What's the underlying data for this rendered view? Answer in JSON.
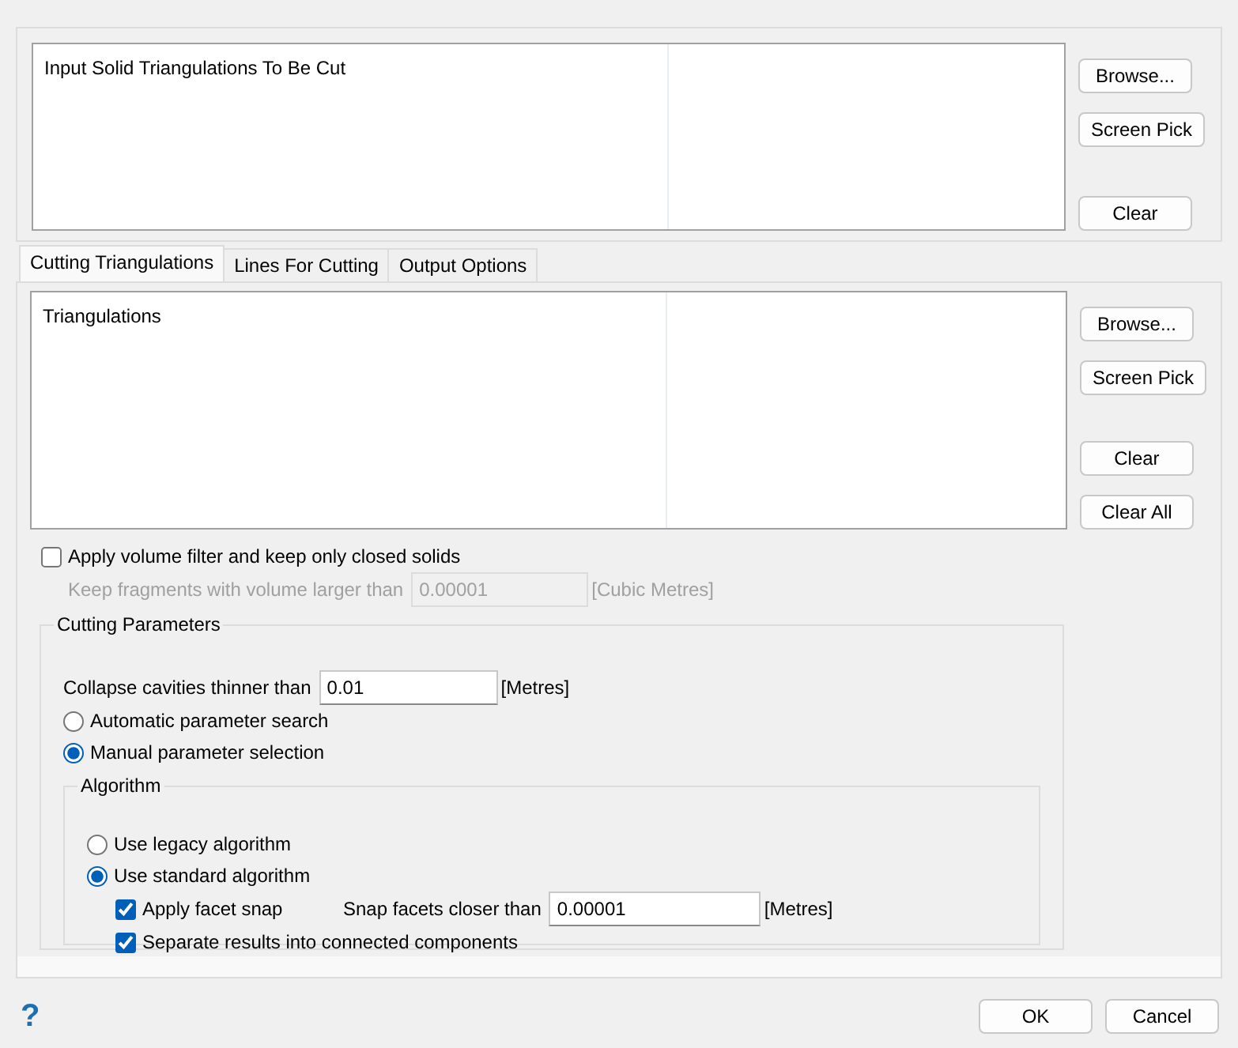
{
  "input_list": {
    "header": "Input Solid Triangulations To Be Cut"
  },
  "input_buttons": [
    "Browse...",
    "Screen Pick",
    "Clear"
  ],
  "tabs": [
    {
      "label": "Cutting Triangulations",
      "selected": true
    },
    {
      "label": "Lines For Cutting",
      "selected": false
    },
    {
      "label": "Output Options",
      "selected": false
    }
  ],
  "cutting_list": {
    "header": "Triangulations"
  },
  "cutting_buttons": [
    "Browse...",
    "Screen Pick",
    "Clear",
    "Clear All"
  ],
  "volume_filter": {
    "label": "Apply volume filter and keep only closed solids",
    "checked": false
  },
  "keep_fragments": {
    "label": "Keep fragments with volume larger than",
    "value": "0.00001",
    "unit": "[Cubic Metres]",
    "disabled": true
  },
  "cutting_parameters": {
    "title": "Cutting Parameters",
    "collapse": {
      "label": "Collapse cavities thinner than",
      "value": "0.01",
      "unit": "[Metres]"
    },
    "modes": [
      {
        "label": "Automatic parameter search",
        "selected": false
      },
      {
        "label": "Manual parameter selection",
        "selected": true
      }
    ],
    "algorithm": {
      "title": "Algorithm",
      "options": [
        {
          "label": "Use legacy algorithm",
          "selected": false
        },
        {
          "label": "Use standard algorithm",
          "selected": true
        }
      ],
      "facet_snap": {
        "label": "Apply facet snap",
        "checked": true,
        "snap_label": "Snap facets closer than",
        "value": "0.00001",
        "unit": "[Metres]"
      },
      "separate": {
        "label": "Separate results into connected components",
        "checked": true
      }
    }
  },
  "help": "?",
  "buttons": [
    "OK",
    "Cancel"
  ]
}
